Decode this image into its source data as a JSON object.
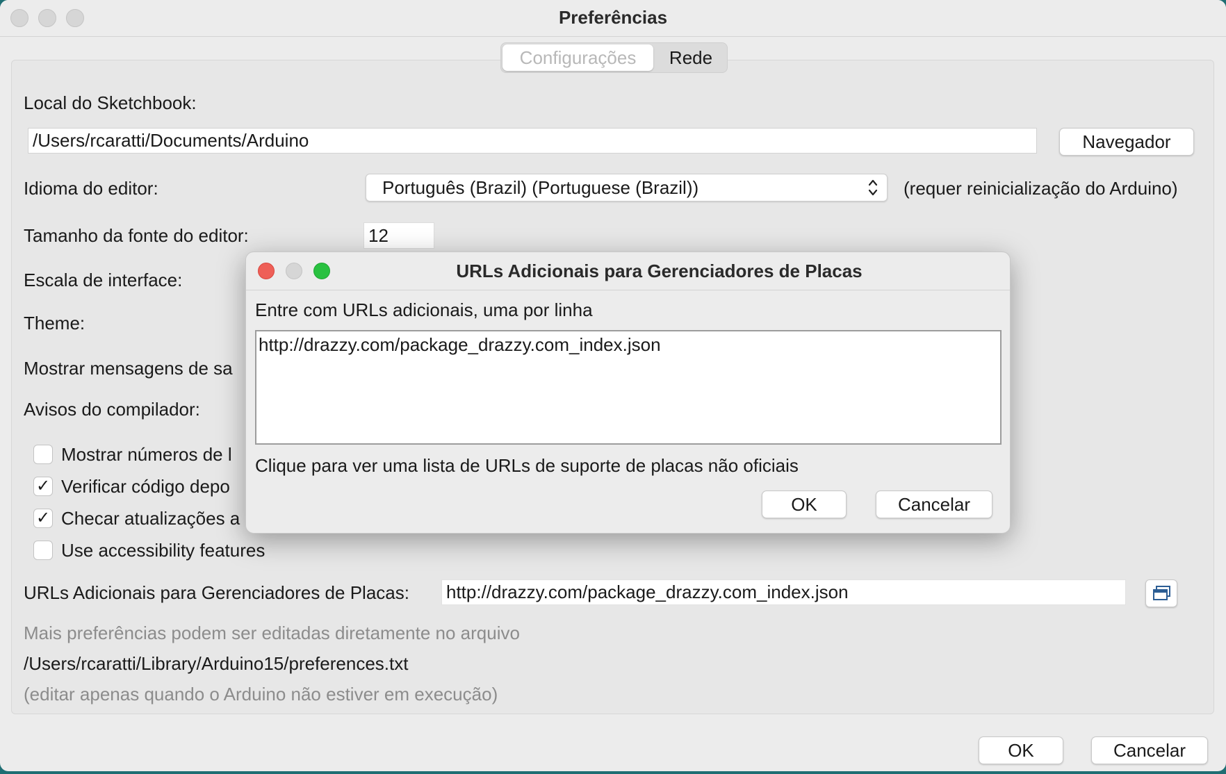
{
  "window": {
    "title": "Preferências",
    "tabs": [
      {
        "label": "Configurações",
        "active": true
      },
      {
        "label": "Rede",
        "active": false
      }
    ]
  },
  "settings": {
    "sketchbook_label": "Local do Sketchbook:",
    "sketchbook_path": "/Users/rcaratti/Documents/Arduino",
    "browse_button": "Navegador",
    "language_label": "Idioma do editor:",
    "language_value": "Português (Brazil) (Portuguese (Brazil))",
    "language_note": "(requer reinicialização do Arduino)",
    "font_size_label": "Tamanho da fonte do editor:",
    "font_size_value": "12",
    "scale_label": "Escala de interface:",
    "theme_label": "Theme:",
    "verbose_label": "Mostrar mensagens de sa",
    "warnings_label": "Avisos do compilador:",
    "checkboxes": [
      {
        "label": "Mostrar números de l",
        "checked": false
      },
      {
        "label": "Verificar código depo",
        "checked": true
      },
      {
        "label": "Checar atualizações a",
        "checked": true
      },
      {
        "label": "Use accessibility features",
        "checked": false
      }
    ],
    "board_urls_label": "URLs Adicionais para Gerenciadores de Placas:",
    "board_urls_value": "http://drazzy.com/package_drazzy.com_index.json",
    "more_prefs_note": "Mais preferências podem ser editadas diretamente no arquivo",
    "prefs_file_path": "/Users/rcaratti/Library/Arduino15/preferences.txt",
    "edit_note": "(editar apenas quando o Arduino não estiver em execução)"
  },
  "footer": {
    "ok_label": "OK",
    "cancel_label": "Cancelar"
  },
  "dialog": {
    "title": "URLs Adicionais para Gerenciadores de Placas",
    "instruction": "Entre com URLs adicionais, uma por linha",
    "urls_text": "http://drazzy.com/package_drazzy.com_index.json",
    "link_text": "Clique para ver uma lista de URLs de suporte de placas não oficiais",
    "ok_label": "OK",
    "cancel_label": "Cancelar"
  },
  "colors": {
    "close": "#ee5f57",
    "minimize_inactive": "#d6d6d6",
    "maximize": "#29c140",
    "window_bg": "#ececec"
  }
}
